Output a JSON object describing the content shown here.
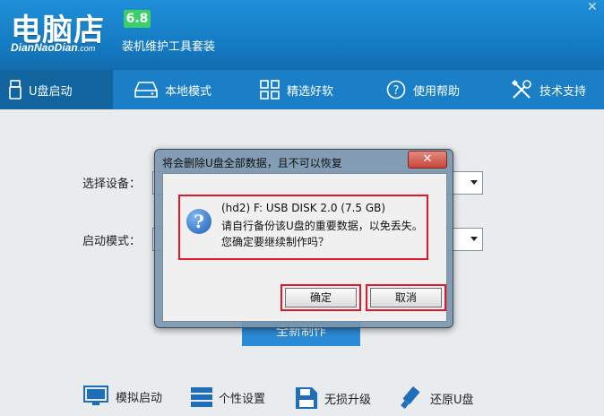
{
  "header": {
    "logo": "电脑店",
    "version": "6.8",
    "logo_sub": "DianNaoDian",
    "logo_sub_suffix": ".com",
    "tagline": "装机维护工具套装"
  },
  "nav": {
    "tabs": [
      {
        "label": "U盘启动",
        "icon": "usb-drive-icon",
        "active": true
      },
      {
        "label": "本地模式",
        "icon": "hard-disk-icon",
        "active": false
      },
      {
        "label": "精选好软",
        "icon": "apps-grid-icon",
        "active": false
      },
      {
        "label": "使用帮助",
        "icon": "help-circle-icon",
        "active": false
      },
      {
        "label": "技术支持",
        "icon": "tools-icon",
        "active": false
      }
    ]
  },
  "main": {
    "device_label": "选择设备：",
    "mode_label": "启动模式：",
    "start_button": "全新制作"
  },
  "bottom": {
    "items": [
      {
        "label": "模拟启动",
        "icon": "monitor-icon"
      },
      {
        "label": "个性设置",
        "icon": "settings-list-icon"
      },
      {
        "label": "无损升级",
        "icon": "save-upgrade-icon"
      },
      {
        "label": "还原U盘",
        "icon": "usb-restore-icon"
      }
    ]
  },
  "dialog": {
    "title": "将会删除U盘全部数据，且不可以恢复",
    "close": "✕",
    "line1": "(hd2) F: USB DISK 2.0 (7.5 GB)",
    "line2": "请自行备份该U盘的重要数据，以免丢失。",
    "line3": "您确定要继续制作吗？",
    "ok": "确定",
    "cancel": "取消"
  },
  "colors": {
    "header_blue": "#1479c0",
    "highlight_red": "#e0182a",
    "version_green": "#39d06a"
  }
}
